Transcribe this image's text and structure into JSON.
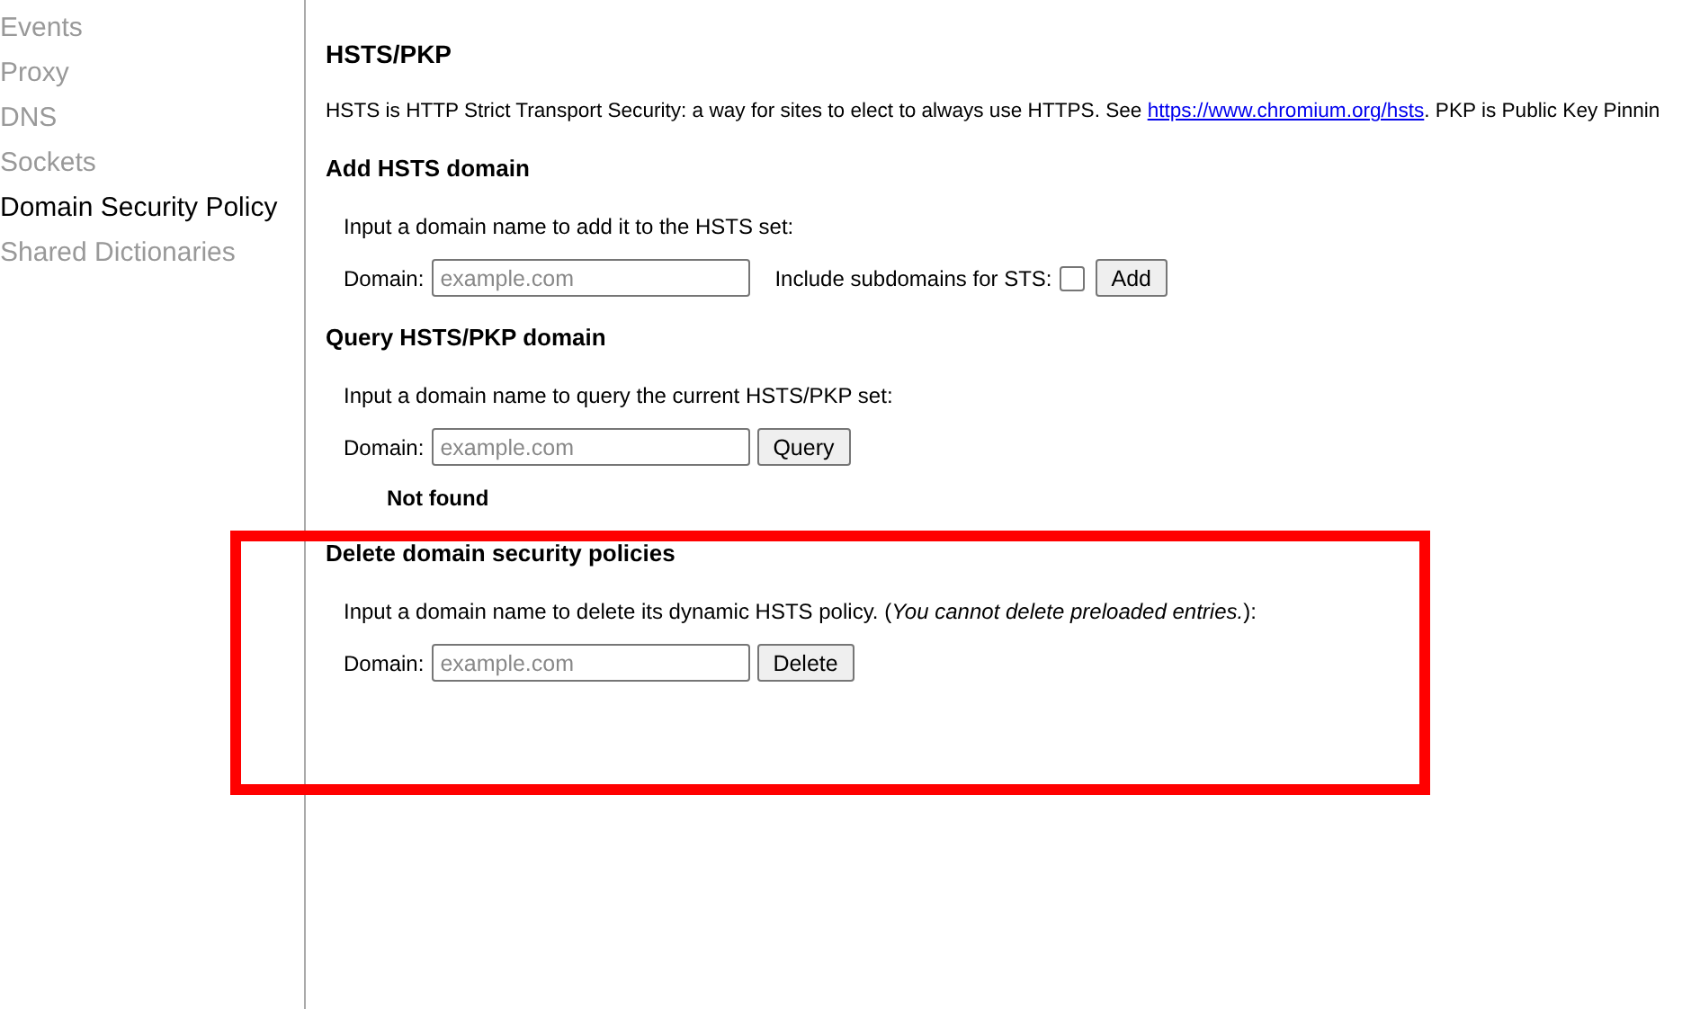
{
  "sidebar": {
    "items": [
      {
        "label": "Events",
        "selected": false
      },
      {
        "label": "Proxy",
        "selected": false
      },
      {
        "label": "DNS",
        "selected": false
      },
      {
        "label": "Sockets",
        "selected": false
      },
      {
        "label": "Domain Security Policy",
        "selected": true
      },
      {
        "label": "Shared Dictionaries",
        "selected": false
      }
    ]
  },
  "page": {
    "title": "HSTS/PKP",
    "description": {
      "before": "HSTS is HTTP Strict Transport Security: a way for sites to elect to always use HTTPS. See",
      "link": "https://www.chromium.org/hsts",
      "after": ". PKP is Public Key Pinnin"
    },
    "sections": [
      {
        "kind": "add",
        "heading": "Add HSTS domain",
        "instruction": "Input a domain name to add it to the HSTS set:",
        "field_label": "Domain:",
        "placeholder": "example.com",
        "checkbox_label": "Include subdomains for STS:",
        "checked": false,
        "button": "Add"
      },
      {
        "kind": "query",
        "heading": "Query HSTS/PKP domain",
        "instruction": "Input a domain name to query the current HSTS/PKP set:",
        "field_label": "Domain:",
        "placeholder": "example.com",
        "button": "Query",
        "result": "Not found"
      },
      {
        "kind": "delete",
        "heading": "Delete domain security policies",
        "instruction": "Input a domain name to delete its dynamic HSTS policy. (*You cannot delete preloaded entries.*):",
        "field_label": "Domain:",
        "placeholder": "example.com",
        "button": "Delete"
      }
    ]
  }
}
